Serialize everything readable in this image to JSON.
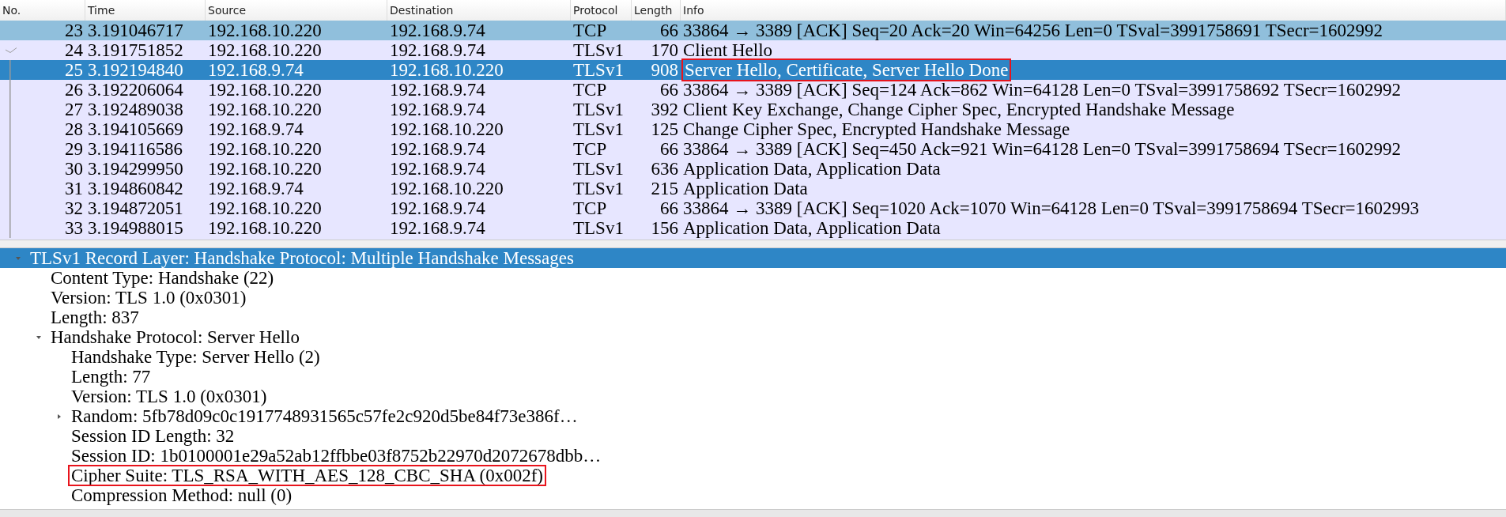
{
  "packet_list": {
    "columns": [
      "No.",
      "Time",
      "Source",
      "Destination",
      "Protocol",
      "Length",
      "Info"
    ],
    "rows": [
      {
        "no": "23",
        "time": "3.191046717",
        "source": "192.168.10.220",
        "destination": "192.168.9.74",
        "protocol": "TCP",
        "length": "66",
        "info": "33864 → 3389 [ACK] Seq=20 Ack=20 Win=64256 Len=0 TSval=3991758691 TSecr=1602992",
        "selected": false,
        "marked": true,
        "highlighted": false
      },
      {
        "no": "24",
        "time": "3.191751852",
        "source": "192.168.10.220",
        "destination": "192.168.9.74",
        "protocol": "TLSv1",
        "length": "170",
        "info": "Client Hello",
        "selected": false,
        "marked": false,
        "highlighted": false
      },
      {
        "no": "25",
        "time": "3.192194840",
        "source": "192.168.9.74",
        "destination": "192.168.10.220",
        "protocol": "TLSv1",
        "length": "908",
        "info": "Server Hello, Certificate, Server Hello Done",
        "selected": true,
        "marked": false,
        "highlighted": true
      },
      {
        "no": "26",
        "time": "3.192206064",
        "source": "192.168.10.220",
        "destination": "192.168.9.74",
        "protocol": "TCP",
        "length": "66",
        "info": "33864 → 3389 [ACK] Seq=124 Ack=862 Win=64128 Len=0 TSval=3991758692 TSecr=1602992",
        "selected": false,
        "marked": false,
        "highlighted": false
      },
      {
        "no": "27",
        "time": "3.192489038",
        "source": "192.168.10.220",
        "destination": "192.168.9.74",
        "protocol": "TLSv1",
        "length": "392",
        "info": "Client Key Exchange, Change Cipher Spec, Encrypted Handshake Message",
        "selected": false,
        "marked": false,
        "highlighted": false
      },
      {
        "no": "28",
        "time": "3.194105669",
        "source": "192.168.9.74",
        "destination": "192.168.10.220",
        "protocol": "TLSv1",
        "length": "125",
        "info": "Change Cipher Spec, Encrypted Handshake Message",
        "selected": false,
        "marked": false,
        "highlighted": false
      },
      {
        "no": "29",
        "time": "3.194116586",
        "source": "192.168.10.220",
        "destination": "192.168.9.74",
        "protocol": "TCP",
        "length": "66",
        "info": "33864 → 3389 [ACK] Seq=450 Ack=921 Win=64128 Len=0 TSval=3991758694 TSecr=1602992",
        "selected": false,
        "marked": false,
        "highlighted": false
      },
      {
        "no": "30",
        "time": "3.194299950",
        "source": "192.168.10.220",
        "destination": "192.168.9.74",
        "protocol": "TLSv1",
        "length": "636",
        "info": "Application Data, Application Data",
        "selected": false,
        "marked": false,
        "highlighted": false
      },
      {
        "no": "31",
        "time": "3.194860842",
        "source": "192.168.9.74",
        "destination": "192.168.10.220",
        "protocol": "TLSv1",
        "length": "215",
        "info": "Application Data",
        "selected": false,
        "marked": false,
        "highlighted": false
      },
      {
        "no": "32",
        "time": "3.194872051",
        "source": "192.168.10.220",
        "destination": "192.168.9.74",
        "protocol": "TCP",
        "length": "66",
        "info": "33864 → 3389 [ACK] Seq=1020 Ack=1070 Win=64128 Len=0 TSval=3991758694 TSecr=1602993",
        "selected": false,
        "marked": false,
        "highlighted": false
      },
      {
        "no": "33",
        "time": "3.194988015",
        "source": "192.168.10.220",
        "destination": "192.168.9.74",
        "protocol": "TLSv1",
        "length": "156",
        "info": "Application Data, Application Data",
        "selected": false,
        "marked": false,
        "highlighted": false
      }
    ]
  },
  "packet_details": {
    "items": [
      {
        "label": "TLSv1 Record Layer: Handshake Protocol: Multiple Handshake Messages",
        "selected": true,
        "expanded": true,
        "highlighted": false,
        "children": [
          {
            "label": "Content Type: Handshake (22)",
            "selected": false,
            "highlighted": false
          },
          {
            "label": "Version: TLS 1.0 (0x0301)",
            "selected": false,
            "highlighted": false
          },
          {
            "label": "Length: 837",
            "selected": false,
            "highlighted": false
          },
          {
            "label": "Handshake Protocol: Server Hello",
            "selected": false,
            "expanded": true,
            "highlighted": false,
            "children": [
              {
                "label": "Handshake Type: Server Hello (2)",
                "selected": false,
                "highlighted": false
              },
              {
                "label": "Length: 77",
                "selected": false,
                "highlighted": false
              },
              {
                "label": "Version: TLS 1.0 (0x0301)",
                "selected": false,
                "highlighted": false
              },
              {
                "label": "Random: 5fb78d09c0c1917748931565c57fe2c920d5be84f73e386f…",
                "selected": false,
                "expanded": false,
                "highlighted": false
              },
              {
                "label": "Session ID Length: 32",
                "selected": false,
                "highlighted": false
              },
              {
                "label": "Session ID: 1b0100001e29a52ab12ffbbe03f8752b22970d2072678dbb…",
                "selected": false,
                "highlighted": false
              },
              {
                "label": "Cipher Suite: TLS_RSA_WITH_AES_128_CBC_SHA (0x002f)",
                "selected": false,
                "highlighted": true
              },
              {
                "label": "Compression Method: null (0)",
                "selected": false,
                "highlighted": false
              }
            ]
          }
        ]
      }
    ]
  }
}
